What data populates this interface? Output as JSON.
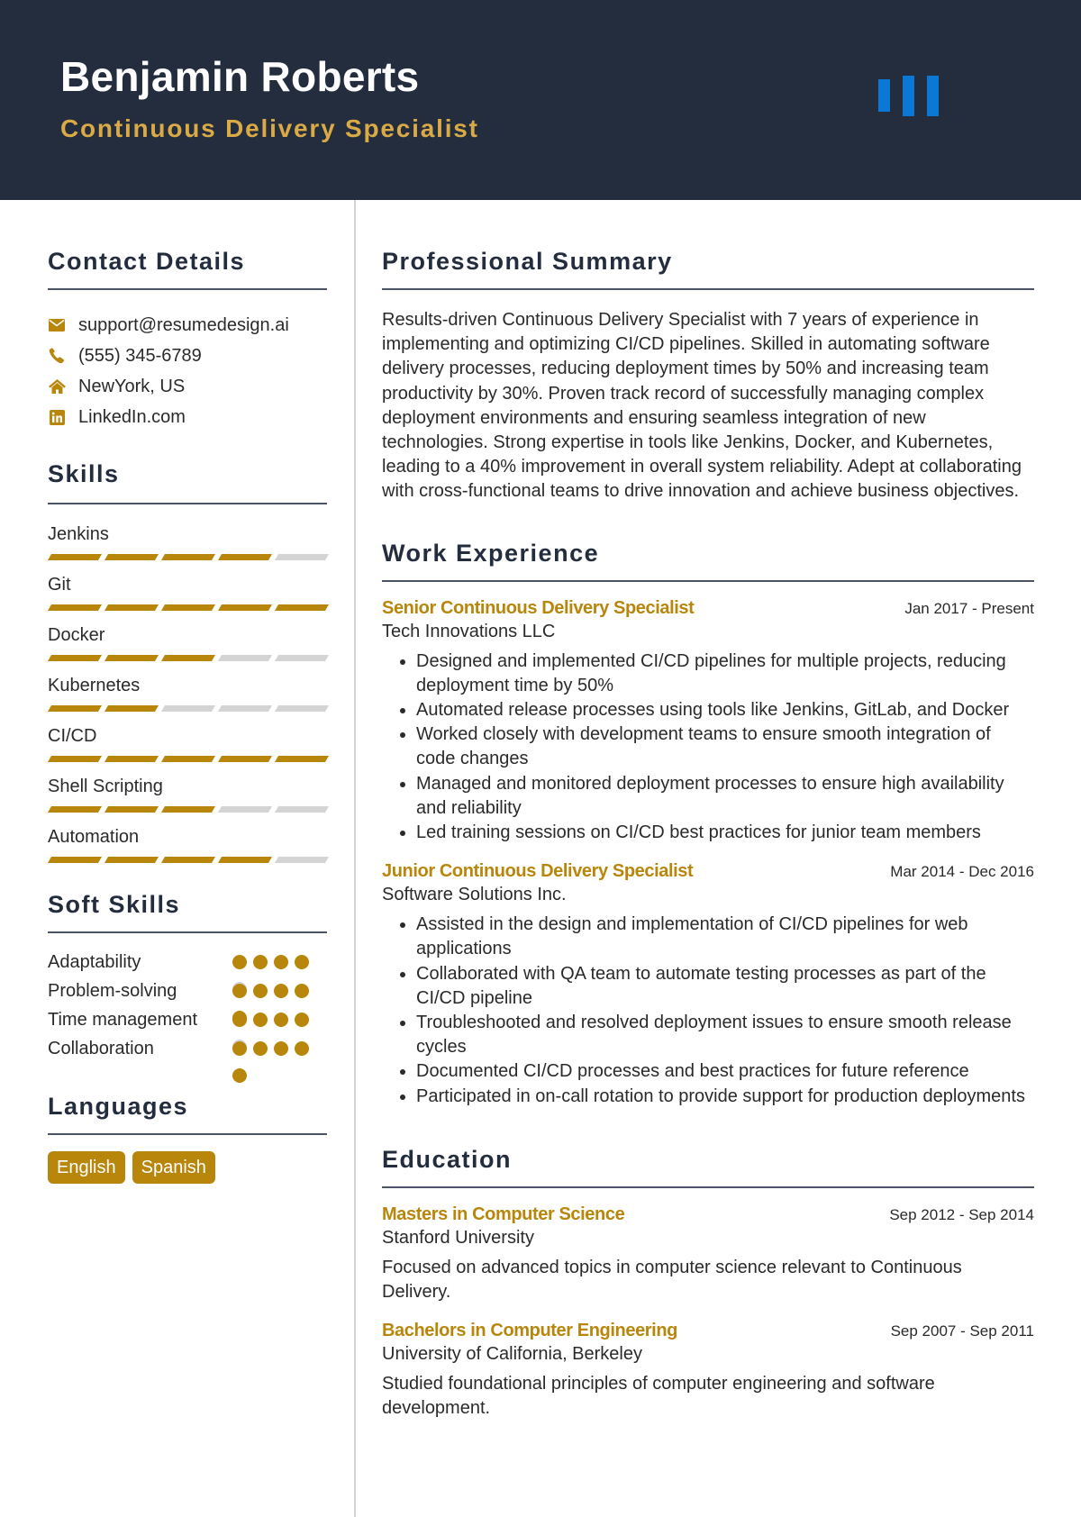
{
  "header": {
    "name": "Benjamin Roberts",
    "title": "Continuous Delivery Specialist",
    "logo_icon": "bar-chart-logo"
  },
  "colors": {
    "header_bg": "#242d3e",
    "accent": "#b8860b",
    "title_gold": "#d9aa45",
    "logo_blue": "#0b78d6",
    "inactive": "#d4d4d4"
  },
  "contact": {
    "heading": "Contact Details",
    "items": [
      {
        "icon": "envelope-icon",
        "text": "support@resumedesign.ai"
      },
      {
        "icon": "phone-icon",
        "text": "(555) 345-6789"
      },
      {
        "icon": "home-icon",
        "text": "NewYork, US"
      },
      {
        "icon": "linkedin-icon",
        "text": "LinkedIn.com"
      }
    ]
  },
  "skills": {
    "heading": "Skills",
    "max": 5,
    "items": [
      {
        "name": "Jenkins",
        "level": 4
      },
      {
        "name": "Git",
        "level": 5
      },
      {
        "name": "Docker",
        "level": 3
      },
      {
        "name": "Kubernetes",
        "level": 2
      },
      {
        "name": "CI/CD",
        "level": 5
      },
      {
        "name": "Shell Scripting",
        "level": 3
      },
      {
        "name": "Automation",
        "level": 4
      }
    ]
  },
  "soft_skills": {
    "heading": "Soft Skills",
    "max": 5,
    "items": [
      {
        "name": "Adaptability",
        "level": 4
      },
      {
        "name": "Problem-solving",
        "level": 5
      },
      {
        "name": "Time management",
        "level": 4
      },
      {
        "name": "Collaboration",
        "level": 5
      }
    ]
  },
  "languages": {
    "heading": "Languages",
    "items": [
      "English",
      "Spanish"
    ]
  },
  "summary": {
    "heading": "Professional Summary",
    "text": "Results-driven Continuous Delivery Specialist with 7 years of experience in implementing and optimizing CI/CD pipelines. Skilled in automating software delivery processes, reducing deployment times by 50% and increasing team productivity by 30%. Proven track record of successfully managing complex deployment environments and ensuring seamless integration of new technologies. Strong expertise in tools like Jenkins, Docker, and Kubernetes, leading to a 40% improvement in overall system reliability. Adept at collaborating with cross-functional teams to drive innovation and achieve business objectives."
  },
  "experience": {
    "heading": "Work Experience",
    "jobs": [
      {
        "title": "Senior Continuous Delivery Specialist",
        "date": "Jan 2017 - Present",
        "company": "Tech Innovations LLC",
        "bullets": [
          "Designed and implemented CI/CD pipelines for multiple projects, reducing deployment time by 50%",
          "Automated release processes using tools like Jenkins, GitLab, and Docker",
          "Worked closely with development teams to ensure smooth integration of code changes",
          "Managed and monitored deployment processes to ensure high availability and reliability",
          "Led training sessions on CI/CD best practices for junior team members"
        ]
      },
      {
        "title": "Junior Continuous Delivery Specialist",
        "date": "Mar 2014 - Dec 2016",
        "company": "Software Solutions Inc.",
        "bullets": [
          "Assisted in the design and implementation of CI/CD pipelines for web applications",
          "Collaborated with QA team to automate testing processes as part of the CI/CD pipeline",
          "Troubleshooted and resolved deployment issues to ensure smooth release cycles",
          "Documented CI/CD processes and best practices for future reference",
          "Participated in on-call rotation to provide support for production deployments"
        ]
      }
    ]
  },
  "education": {
    "heading": "Education",
    "items": [
      {
        "degree": "Masters in Computer Science",
        "date": "Sep 2012 - Sep 2014",
        "school": "Stanford University",
        "description": "Focused on advanced topics in computer science relevant to Continuous Delivery."
      },
      {
        "degree": "Bachelors in Computer Engineering",
        "date": "Sep 2007 - Sep 2011",
        "school": "University of California, Berkeley",
        "description": "Studied foundational principles of computer engineering and software development."
      }
    ]
  }
}
